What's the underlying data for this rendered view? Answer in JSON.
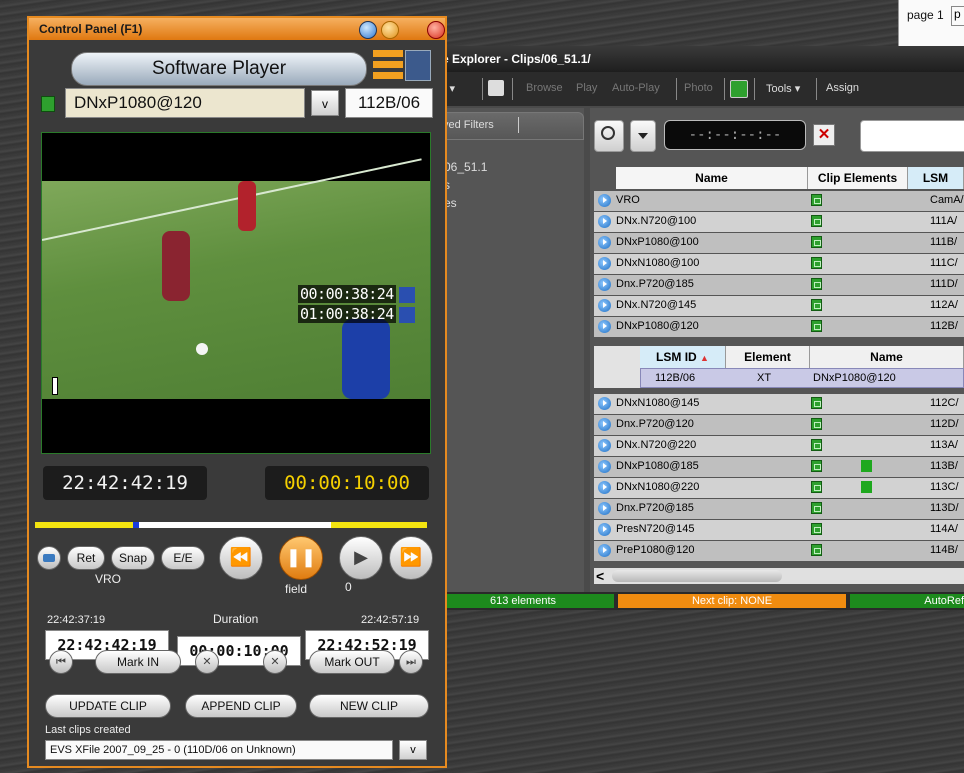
{
  "page_tab": {
    "label": "page 1",
    "next": "p"
  },
  "explorer": {
    "title": "e Explorer - Clips/06_51.1/",
    "toolbar": {
      "view": "iew ▾",
      "browse": "Browse",
      "play": "Play",
      "auto_play": "Auto-Play",
      "photo": "Photo",
      "tools": "Tools ▾",
      "assign": "Assign"
    },
    "left": {
      "filters_tab": "ved Filters",
      "tree": [
        "06_51.1",
        "s",
        "es"
      ]
    },
    "search": {
      "timecode_placeholder": "--:--:--:--",
      "clear": "✕"
    },
    "table": {
      "headers": {
        "name": "Name",
        "clip_elements": "Clip Elements",
        "lsm": "LSM"
      },
      "rows_top": [
        {
          "name": "VRO",
          "lsm": "CamA/"
        },
        {
          "name": "DNx.N720@100",
          "lsm": "111A/"
        },
        {
          "name": "DNxP1080@100",
          "lsm": "111B/"
        },
        {
          "name": "DNxN1080@100",
          "lsm": "111C/"
        },
        {
          "name": "Dnx.P720@185",
          "lsm": "111D/"
        },
        {
          "name": "DNx.N720@145",
          "lsm": "112A/"
        },
        {
          "name": "DNxP1080@120",
          "lsm": "112B/"
        }
      ],
      "sub_headers": {
        "lsm_id": "LSM ID",
        "sort": "▲",
        "element": "Element",
        "name": "Name"
      },
      "sub_row": {
        "lsm_id": "112B/06",
        "element": "XT",
        "name": "DNxP1080@120"
      },
      "rows_bottom": [
        {
          "name": "DNxN1080@145",
          "lsm": "112C/"
        },
        {
          "name": "Dnx.P720@120",
          "lsm": "112D/"
        },
        {
          "name": "DNx.N720@220",
          "lsm": "113A/"
        },
        {
          "name": "DNxP1080@185",
          "lsm": "113B/"
        },
        {
          "name": "DNxN1080@220",
          "lsm": "113C/"
        },
        {
          "name": "Dnx.P720@185",
          "lsm": "113D/"
        },
        {
          "name": "PresN720@145",
          "lsm": "114A/"
        },
        {
          "name": "PreP1080@120",
          "lsm": "114B/"
        }
      ]
    },
    "status": {
      "elements": "613 elements",
      "next_clip": "Next clip: NONE",
      "autorefresh": "AutoRef"
    }
  },
  "control_panel": {
    "title": "Control Panel (F1)",
    "player": "Software Player",
    "clip_name": "DNxP1080@120",
    "dropdown": "v",
    "clip_id": "112B/06",
    "overlay_tc1": "00:00:38:24",
    "overlay_tc2": "01:00:38:24",
    "current_tc": "22:42:42:19",
    "remaining_tc": "00:00:10:00",
    "buttons": {
      "ret": "Ret",
      "snap": "Snap",
      "ee": "E/E"
    },
    "source": "VRO",
    "field_label": "field",
    "field_value": "0",
    "in_tc_small": "22:42:37:19",
    "duration_label": "Duration",
    "out_tc_small": "22:42:57:19",
    "in_tc": "22:42:42:19",
    "duration": "00:00:10:00",
    "out_tc": "22:42:52:19",
    "mark_in": "Mark IN",
    "mark_out": "Mark OUT",
    "update_clip": "UPDATE CLIP",
    "append_clip": "APPEND CLIP",
    "new_clip": "NEW CLIP",
    "last_clips_label": "Last clips created",
    "last_clip": "EVS XFile 2007_09_25 - 0 (110D/06 on Unknown)",
    "last_dd": "v"
  },
  "colors": {
    "accent_orange": "#e68a20",
    "progress_yellow": "#f3e410",
    "status_green": "#1d8a1d",
    "status_orange": "#f08c10"
  }
}
